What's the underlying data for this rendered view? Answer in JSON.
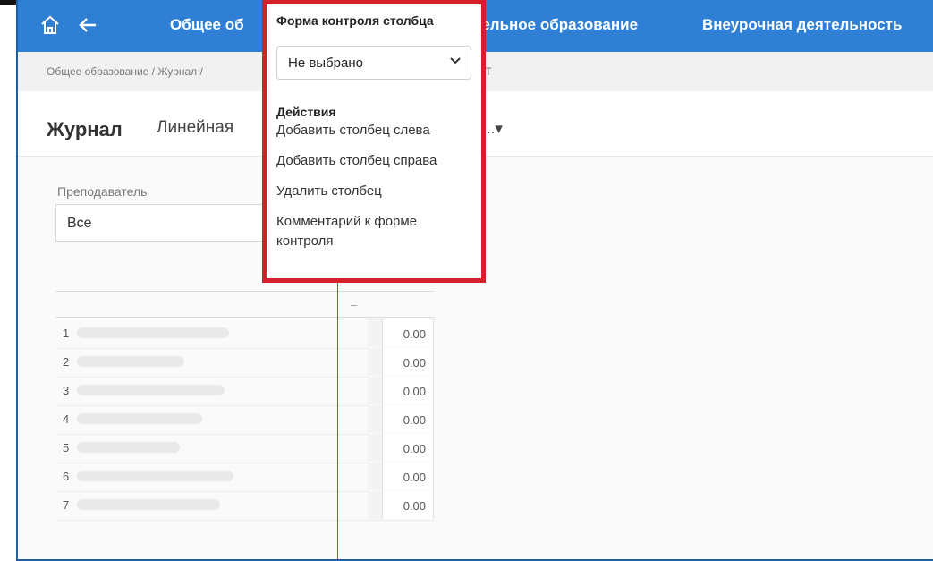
{
  "nav": {
    "links": [
      "Общее об",
      "тельное образование",
      "Внеурочная деятельность"
    ]
  },
  "breadcrumb": {
    "left": "Общее образование / Журнал /",
    "right": "ЕСТ"
  },
  "titlebar": {
    "title": "Журнал",
    "tab": "Линейная",
    "more": "тр...▾"
  },
  "filter": {
    "teacher_label": "Преподаватель",
    "teacher_value": "Все"
  },
  "table": {
    "dash": "–",
    "rows": [
      {
        "num": "1",
        "value": "0.00"
      },
      {
        "num": "2",
        "value": "0.00"
      },
      {
        "num": "3",
        "value": "0.00"
      },
      {
        "num": "4",
        "value": "0.00"
      },
      {
        "num": "5",
        "value": "0.00"
      },
      {
        "num": "6",
        "value": "0.00"
      },
      {
        "num": "7",
        "value": "0.00"
      }
    ]
  },
  "popup": {
    "title": "Форма контроля столбца",
    "select_value": "Не выбрано",
    "actions_heading": "Действия",
    "actions": [
      "Добавить столбец слева",
      "Добавить столбец справа",
      "Удалить столбец",
      "Комментарий к форме",
      "контроля"
    ]
  },
  "colors": {
    "navbar": "#2f80d4",
    "highlight_border": "#d4202a"
  }
}
